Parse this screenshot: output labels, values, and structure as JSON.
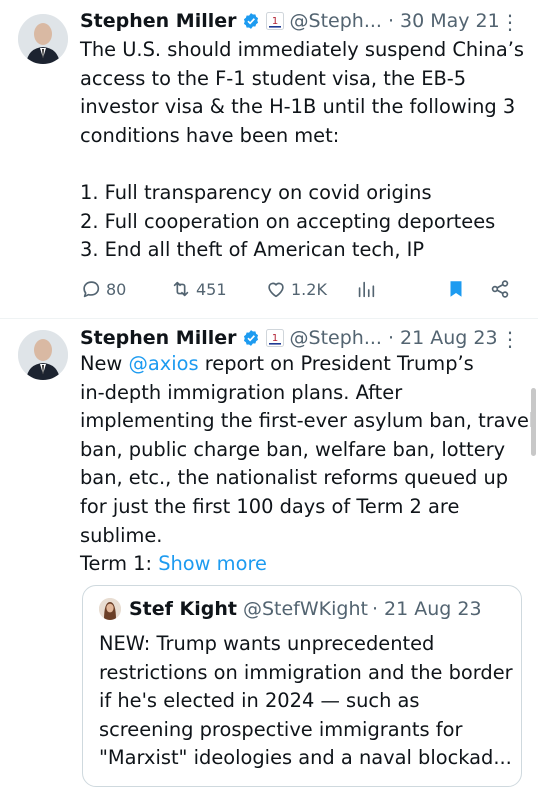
{
  "tweets": [
    {
      "author": {
        "name": "Stephen Miller",
        "handle": "@Steph...",
        "date": "· 30 May 21",
        "flag_label": "1"
      },
      "text_lines": [
        "The U.S. should immediately suspend China’s",
        "access to the F-1 student visa, the EB-5",
        "investor visa & the H-1B until the following 3",
        "conditions have been met:",
        "",
        "1. Full transparency on covid origins",
        "2. Full cooperation on accepting deportees",
        "3. End all theft of American tech, IP"
      ],
      "actions": {
        "replies": "80",
        "retweets": "451",
        "likes": "1.2K"
      }
    },
    {
      "author": {
        "name": "Stephen Miller",
        "handle": "@Steph...",
        "date": "· 21 Aug 23",
        "flag_label": "1"
      },
      "text": {
        "prefix": "New ",
        "mention": "@axios",
        "line1_rest": " report on President Trump’s",
        "lines": [
          "in-depth immigration plans. After",
          "implementing the first-ever asylum ban, travel",
          "ban, public charge ban, welfare ban, lottery",
          "ban, etc., the nationalist reforms queued up",
          "for just the first 100 days of Term 2 are",
          "sublime."
        ],
        "term_prefix": "Term 1: ",
        "show_more": "Show more"
      },
      "quote": {
        "name": "Stef Kight",
        "handle": "@StefWKight",
        "date": "· 21 Aug 23",
        "lines": [
          "NEW: Trump wants unprecedented",
          "restrictions on immigration and the border",
          "if he's elected in 2024 — such as",
          "screening prospective immigrants for",
          "\"Marxist\" ideologies and a naval blockad..."
        ]
      }
    }
  ],
  "more_icon": "⋮",
  "colors": {
    "accent": "#1d9bf0",
    "muted": "#536471",
    "text": "#0f1419",
    "bookmark": "#1d9bf0"
  }
}
